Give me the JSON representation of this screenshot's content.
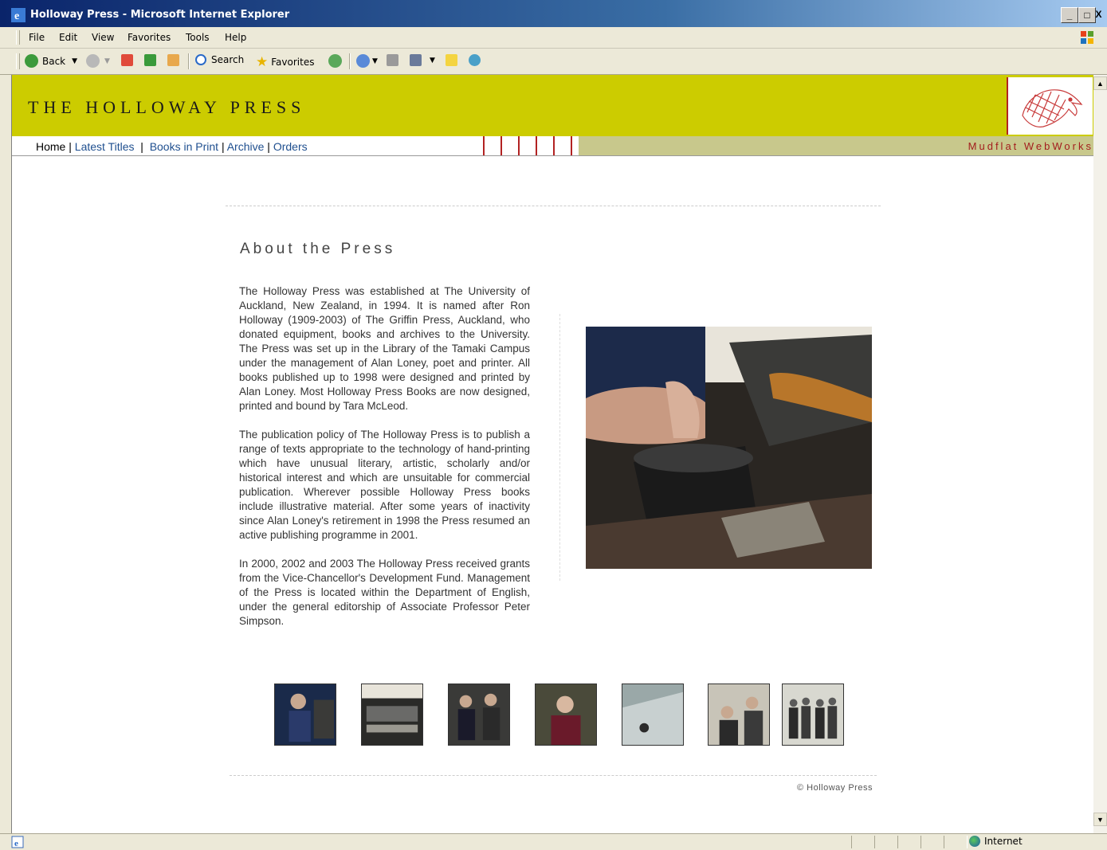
{
  "window": {
    "title": "Holloway Press - Microsoft Internet Explorer",
    "controls": [
      "_",
      "□",
      "X"
    ]
  },
  "menu": {
    "items": [
      "File",
      "Edit",
      "View",
      "Favorites",
      "Tools",
      "Help"
    ]
  },
  "toolbar": {
    "back_label": "Back",
    "search_label": "Search",
    "favorites_label": "Favorites"
  },
  "site": {
    "title": "THE HOLLOWAY PRESS",
    "nav": {
      "home": "Home",
      "latest": "Latest Titles",
      "books": "Books in Print",
      "archive": "Archive",
      "orders": "Orders"
    },
    "webworks": "Mudflat WebWorks"
  },
  "content": {
    "heading": "About the Press",
    "paragraphs": [
      "The Holloway Press was established at The University of Auckland, New Zealand, in 1994. It is named after Ron Holloway (1909-2003) of The Griffin Press, Auckland, who donated equipment, books and archives to the University. The Press was set up in the Library of the Tamaki Campus under the management of Alan Loney, poet and printer. All books published up to 1998 were designed and printed by Alan Loney. Most Holloway Press Books are now designed, printed and bound by Tara McLeod.",
      "The publication policy of The Holloway Press is to publish a range of texts appropriate to the technology of hand-printing which have unusual literary, artistic, scholarly and/or historical interest and which are unsuitable for commercial publication. Wherever possible Holloway Press books include illustrative material. After some years of inactivity since Alan Loney's retirement in 1998 the Press resumed an active publishing programme in 2001.",
      "In 2000, 2002 and 2003 The Holloway Press received grants from the Vice-Chancellor's Development Fund. Management of the Press is located within the Department of English, under the general editorship of Associate Professor Peter Simpson."
    ],
    "copyright": "© Holloway Press"
  },
  "status": {
    "zone": "Internet"
  },
  "colors": {
    "header_bg": "#cccc00",
    "accent_red": "#b22222",
    "link_blue": "#1f4f8f",
    "band_khaki": "#c8c88c"
  }
}
